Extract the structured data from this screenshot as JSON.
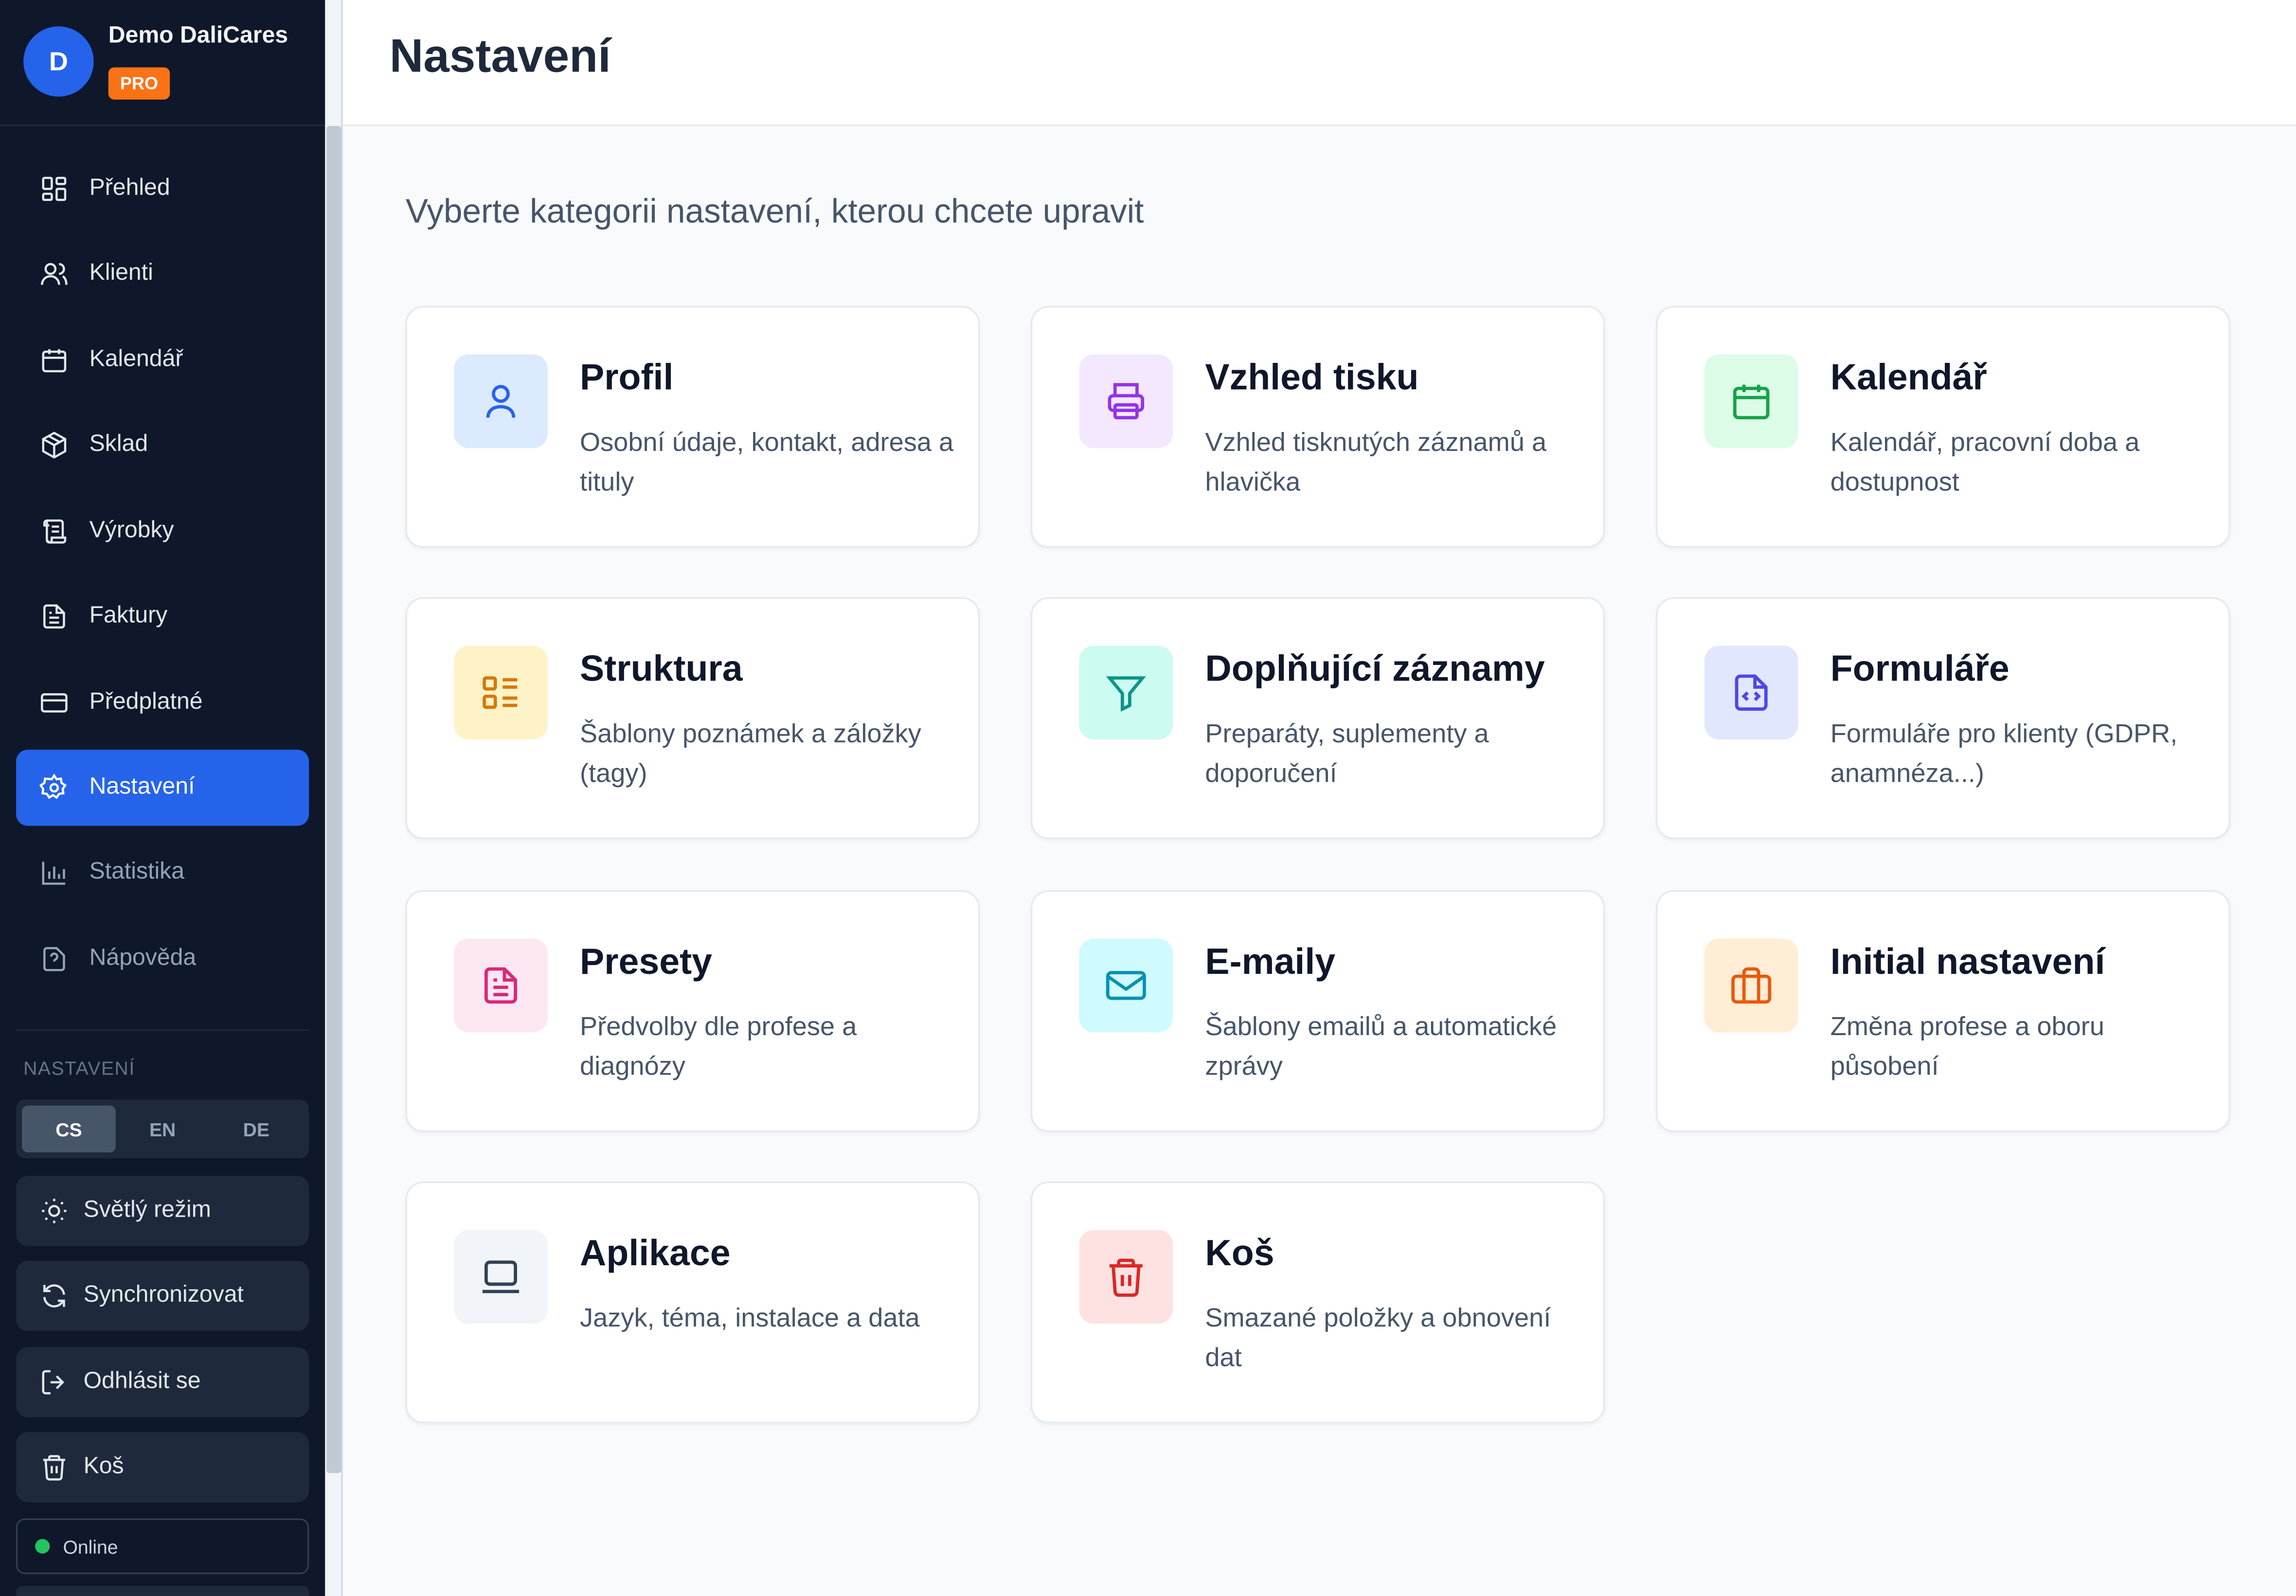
{
  "user": {
    "initial": "D",
    "name": "Demo DaliCares",
    "badge": "PRO"
  },
  "nav": [
    {
      "label": "Přehled",
      "icon": "dashboard-icon"
    },
    {
      "label": "Klienti",
      "icon": "users-icon"
    },
    {
      "label": "Kalendář",
      "icon": "calendar-icon"
    },
    {
      "label": "Sklad",
      "icon": "package-icon"
    },
    {
      "label": "Výrobky",
      "icon": "scroll-icon"
    },
    {
      "label": "Faktury",
      "icon": "invoice-icon"
    },
    {
      "label": "Předplatné",
      "icon": "credit-card-icon"
    },
    {
      "label": "Nastavení",
      "icon": "gear-icon",
      "active": true
    },
    {
      "label": "Statistika",
      "icon": "bar-chart-icon"
    },
    {
      "label": "Nápověda",
      "icon": "help-icon"
    }
  ],
  "settings_section": {
    "label": "NASTAVENÍ",
    "languages": [
      "CS",
      "EN",
      "DE"
    ],
    "active_language": "CS",
    "actions": [
      {
        "label": "Světlý režim",
        "icon": "sun-icon"
      },
      {
        "label": "Synchronizovat",
        "icon": "sync-icon"
      },
      {
        "label": "Odhlásit se",
        "icon": "logout-icon"
      },
      {
        "label": "Koš",
        "icon": "trash-icon"
      }
    ],
    "status": "Online"
  },
  "header": {
    "title": "Nastavení"
  },
  "main": {
    "subtitle": "Vyberte kategorii nastavení, kterou chcete upravit",
    "cards": [
      {
        "title": "Profil",
        "desc": "Osobní údaje, kontakt, adresa a tituly",
        "icon": "user-icon",
        "bg": "#dbeafe",
        "color": "#2563eb"
      },
      {
        "title": "Vzhled tisku",
        "desc": "Vzhled tisknutých záznamů a hlavička",
        "icon": "printer-icon",
        "bg": "#f3e8ff",
        "color": "#9333ea"
      },
      {
        "title": "Kalendář",
        "desc": "Kalendář, pracovní doba a dostupnost",
        "icon": "calendar-icon",
        "bg": "#dcfce7",
        "color": "#16a34a"
      },
      {
        "title": "Struktura",
        "desc": "Šablony poznámek a záložky (tagy)",
        "icon": "list-icon",
        "bg": "#fef3c7",
        "color": "#d97706"
      },
      {
        "title": "Doplňující záznamy",
        "desc": "Preparáty, suplementy a doporučení",
        "icon": "filter-icon",
        "bg": "#ccfbf1",
        "color": "#0d9488"
      },
      {
        "title": "Formuláře",
        "desc": "Formuláře pro klienty (GDPR, anamnéza...)",
        "icon": "file-code-icon",
        "bg": "#e0e7ff",
        "color": "#4f46e5"
      },
      {
        "title": "Presety",
        "desc": "Předvolby dle profese a diagnózy",
        "icon": "document-icon",
        "bg": "#fce7f3",
        "color": "#db2777"
      },
      {
        "title": "E-maily",
        "desc": "Šablony emailů a automatické zprávy",
        "icon": "mail-icon",
        "bg": "#cffafe",
        "color": "#0891b2"
      },
      {
        "title": "Initial nastavení",
        "desc": "Změna profese a oboru působení",
        "icon": "briefcase-icon",
        "bg": "#ffedd5",
        "color": "#ea580c"
      },
      {
        "title": "Aplikace",
        "desc": "Jazyk, téma, instalace a data",
        "icon": "laptop-icon",
        "bg": "#f1f5f9",
        "color": "#334155"
      },
      {
        "title": "Koš",
        "desc": "Smazané položky a obnovení dat",
        "icon": "trash-icon",
        "bg": "#fee2e2",
        "color": "#dc2626"
      }
    ]
  }
}
